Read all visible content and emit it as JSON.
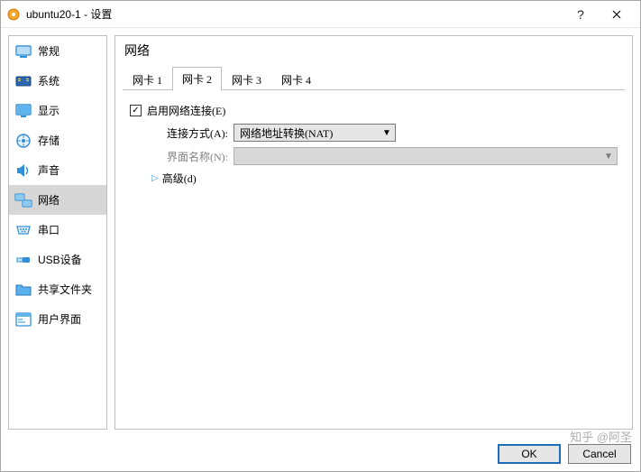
{
  "window": {
    "title": "ubuntu20-1 - 设置"
  },
  "sidebar": {
    "items": [
      {
        "label": "常规"
      },
      {
        "label": "系统"
      },
      {
        "label": "显示"
      },
      {
        "label": "存储"
      },
      {
        "label": "声音"
      },
      {
        "label": "网络"
      },
      {
        "label": "串口"
      },
      {
        "label": "USB设备"
      },
      {
        "label": "共享文件夹"
      },
      {
        "label": "用户界面"
      }
    ],
    "selected_index": 5
  },
  "main": {
    "title": "网络",
    "tabs": [
      {
        "label": "网卡 1"
      },
      {
        "label": "网卡 2"
      },
      {
        "label": "网卡 3"
      },
      {
        "label": "网卡 4"
      }
    ],
    "active_tab_index": 1,
    "enable_adapter": {
      "label": "启用网络连接(E)",
      "checked": true
    },
    "attached_to": {
      "label": "连接方式(A):",
      "value": "网络地址转换(NAT)"
    },
    "interface_name": {
      "label": "界面名称(N):",
      "value": "",
      "disabled": true
    },
    "advanced": {
      "label": "高级(d)"
    }
  },
  "footer": {
    "ok": "OK",
    "cancel": "Cancel"
  },
  "watermark": "知乎 @阿圣"
}
